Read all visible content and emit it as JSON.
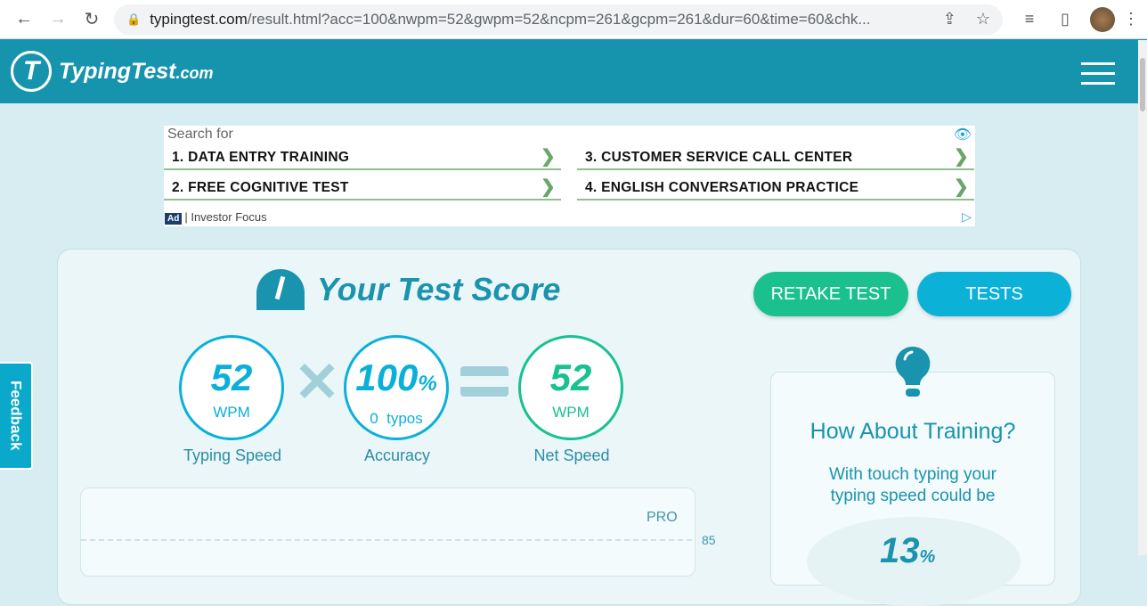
{
  "browser": {
    "url_host": "typingtest.com",
    "url_rest": "/result.html?acc=100&nwpm=52&gwpm=52&ncpm=261&gcpm=261&dur=60&time=60&chk..."
  },
  "header": {
    "logo": "TypingTest",
    "logo_suffix": ".com"
  },
  "ad": {
    "search_for": "Search for",
    "items": [
      "1. DATA ENTRY TRAINING",
      "2. FREE COGNITIVE TEST",
      "3. CUSTOMER SERVICE CALL CENTER",
      "4. ENGLISH CONVERSATION PRACTICE"
    ],
    "badge": "Ad",
    "sponsor": "Investor Focus"
  },
  "score": {
    "title": "Your Test Score",
    "retake": "RETAKE TEST",
    "tests": "TESTS",
    "typing_speed": {
      "value": "52",
      "unit": "WPM",
      "label": "Typing Speed"
    },
    "accuracy": {
      "value": "100",
      "suffix": "%",
      "sub": "0  typos",
      "label": "Accuracy"
    },
    "net_speed": {
      "value": "52",
      "unit": "WPM",
      "label": "Net Speed"
    }
  },
  "chart": {
    "pro_label": "PRO",
    "pro_value": "85"
  },
  "training": {
    "title": "How About Training?",
    "text": "With touch typing your typing speed could be",
    "percent": "13"
  },
  "feedback": "Feedback"
}
